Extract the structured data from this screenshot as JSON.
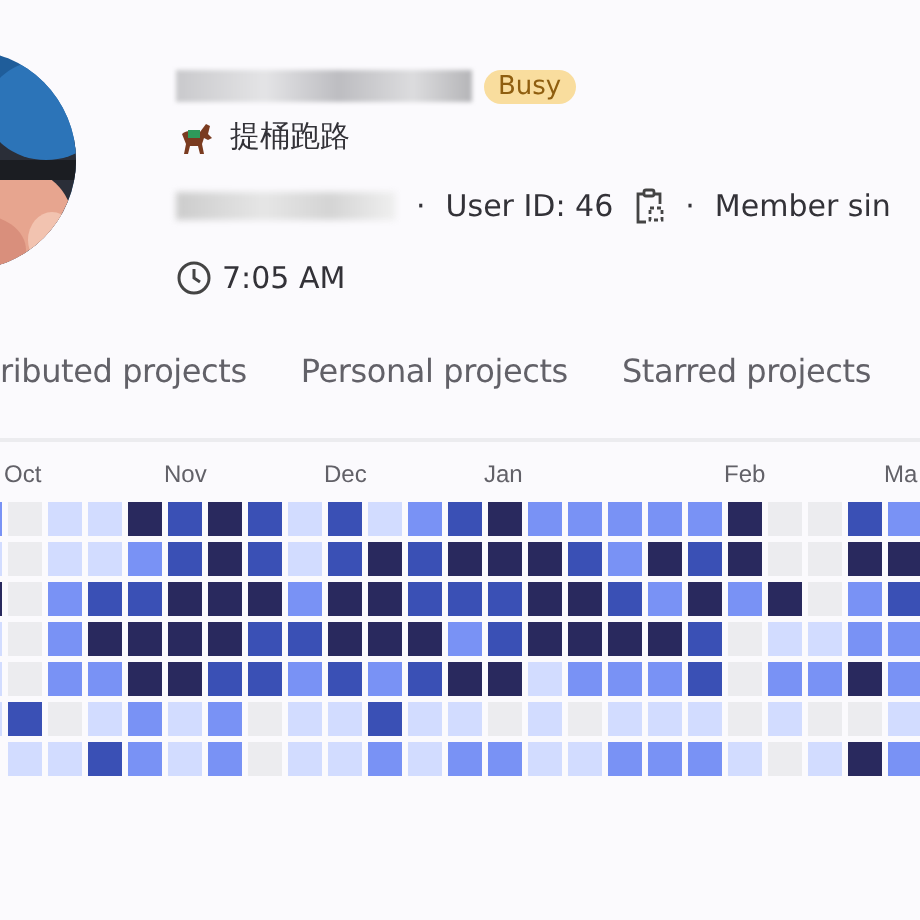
{
  "profile": {
    "badge": "Busy",
    "status": "提桶跑路",
    "separator_1": "·",
    "user_id": "User ID: 46",
    "separator_2": "·",
    "member_since": "Member sin",
    "local_time": "7:05 AM"
  },
  "tabs": [
    {
      "label": "ributed projects"
    },
    {
      "label": "Personal projects"
    },
    {
      "label": "Starred projects"
    }
  ],
  "calendar": {
    "weeks": [
      {
        "days": [
          {
            "color": "#7992f5"
          },
          {
            "color": "#d2dcff"
          },
          {
            "color": "#29295e"
          },
          {
            "color": "#d2dcff"
          },
          {
            "color": "#d2dcff"
          },
          {
            "color": "#d2dcff"
          }
        ]
      },
      {
        "month": "Oct",
        "days": [
          {
            "color": "#ececef"
          },
          {
            "color": "#ececef"
          },
          {
            "color": "#ececef"
          },
          {
            "color": "#ececef"
          },
          {
            "color": "#ececef"
          },
          {
            "color": "#3a50b5"
          },
          {
            "color": "#d2dcff"
          }
        ]
      },
      {
        "days": [
          {
            "color": "#d2dcff"
          },
          {
            "color": "#d2dcff"
          },
          {
            "color": "#7992f5"
          },
          {
            "color": "#7992f5"
          },
          {
            "color": "#7992f5"
          },
          {
            "color": "#ececef"
          },
          {
            "color": "#d2dcff"
          }
        ]
      },
      {
        "days": [
          {
            "color": "#d2dcff"
          },
          {
            "color": "#d2dcff"
          },
          {
            "color": "#3a50b5"
          },
          {
            "color": "#29295e"
          },
          {
            "color": "#7992f5"
          },
          {
            "color": "#d2dcff"
          },
          {
            "color": "#3a50b5"
          }
        ]
      },
      {
        "days": [
          {
            "color": "#29295e"
          },
          {
            "color": "#7992f5"
          },
          {
            "color": "#3a50b5"
          },
          {
            "color": "#29295e"
          },
          {
            "color": "#29295e"
          },
          {
            "color": "#7992f5"
          },
          {
            "color": "#7992f5"
          }
        ]
      },
      {
        "month": "Nov",
        "days": [
          {
            "color": "#3a50b5"
          },
          {
            "color": "#3a50b5"
          },
          {
            "color": "#29295e"
          },
          {
            "color": "#29295e"
          },
          {
            "color": "#29295e"
          },
          {
            "color": "#d2dcff"
          },
          {
            "color": "#d2dcff"
          }
        ]
      },
      {
        "days": [
          {
            "color": "#29295e"
          },
          {
            "color": "#29295e"
          },
          {
            "color": "#29295e"
          },
          {
            "color": "#29295e"
          },
          {
            "color": "#3a50b5"
          },
          {
            "color": "#7992f5"
          },
          {
            "color": "#7992f5"
          }
        ]
      },
      {
        "days": [
          {
            "color": "#3a50b5"
          },
          {
            "color": "#3a50b5"
          },
          {
            "color": "#29295e"
          },
          {
            "color": "#3a50b5"
          },
          {
            "color": "#3a50b5"
          },
          {
            "color": "#ececef"
          },
          {
            "color": "#ececef"
          }
        ]
      },
      {
        "days": [
          {
            "color": "#d2dcff"
          },
          {
            "color": "#d2dcff"
          },
          {
            "color": "#7992f5"
          },
          {
            "color": "#3a50b5"
          },
          {
            "color": "#7992f5"
          },
          {
            "color": "#d2dcff"
          },
          {
            "color": "#d2dcff"
          }
        ]
      },
      {
        "month": "Dec",
        "days": [
          {
            "color": "#3a50b5"
          },
          {
            "color": "#3a50b5"
          },
          {
            "color": "#29295e"
          },
          {
            "color": "#29295e"
          },
          {
            "color": "#3a50b5"
          },
          {
            "color": "#d2dcff"
          },
          {
            "color": "#d2dcff"
          }
        ]
      },
      {
        "days": [
          {
            "color": "#d2dcff"
          },
          {
            "color": "#29295e"
          },
          {
            "color": "#29295e"
          },
          {
            "color": "#29295e"
          },
          {
            "color": "#7992f5"
          },
          {
            "color": "#3a50b5"
          },
          {
            "color": "#7992f5"
          }
        ]
      },
      {
        "days": [
          {
            "color": "#7992f5"
          },
          {
            "color": "#3a50b5"
          },
          {
            "color": "#3a50b5"
          },
          {
            "color": "#29295e"
          },
          {
            "color": "#3a50b5"
          },
          {
            "color": "#d2dcff"
          },
          {
            "color": "#d2dcff"
          }
        ]
      },
      {
        "days": [
          {
            "color": "#3a50b5"
          },
          {
            "color": "#29295e"
          },
          {
            "color": "#3a50b5"
          },
          {
            "color": "#7992f5"
          },
          {
            "color": "#29295e"
          },
          {
            "color": "#d2dcff"
          },
          {
            "color": "#7992f5"
          }
        ]
      },
      {
        "month": "Jan",
        "days": [
          {
            "color": "#29295e"
          },
          {
            "color": "#29295e"
          },
          {
            "color": "#3a50b5"
          },
          {
            "color": "#3a50b5"
          },
          {
            "color": "#29295e"
          },
          {
            "color": "#ececef"
          },
          {
            "color": "#7992f5"
          }
        ]
      },
      {
        "days": [
          {
            "color": "#7992f5"
          },
          {
            "color": "#29295e"
          },
          {
            "color": "#29295e"
          },
          {
            "color": "#29295e"
          },
          {
            "color": "#d2dcff"
          },
          {
            "color": "#d2dcff"
          },
          {
            "color": "#d2dcff"
          }
        ]
      },
      {
        "days": [
          {
            "color": "#7992f5"
          },
          {
            "color": "#3a50b5"
          },
          {
            "color": "#29295e"
          },
          {
            "color": "#29295e"
          },
          {
            "color": "#7992f5"
          },
          {
            "color": "#ececef"
          },
          {
            "color": "#d2dcff"
          }
        ]
      },
      {
        "days": [
          {
            "color": "#7992f5"
          },
          {
            "color": "#7992f5"
          },
          {
            "color": "#3a50b5"
          },
          {
            "color": "#29295e"
          },
          {
            "color": "#7992f5"
          },
          {
            "color": "#d2dcff"
          },
          {
            "color": "#7992f5"
          }
        ]
      },
      {
        "days": [
          {
            "color": "#7992f5"
          },
          {
            "color": "#29295e"
          },
          {
            "color": "#7992f5"
          },
          {
            "color": "#29295e"
          },
          {
            "color": "#7992f5"
          },
          {
            "color": "#d2dcff"
          },
          {
            "color": "#7992f5"
          }
        ]
      },
      {
        "days": [
          {
            "color": "#7992f5"
          },
          {
            "color": "#3a50b5"
          },
          {
            "color": "#29295e"
          },
          {
            "color": "#3a50b5"
          },
          {
            "color": "#3a50b5"
          },
          {
            "color": "#d2dcff"
          },
          {
            "color": "#7992f5"
          }
        ]
      },
      {
        "month": "Feb",
        "days": [
          {
            "color": "#29295e"
          },
          {
            "color": "#29295e"
          },
          {
            "color": "#7992f5"
          },
          {
            "color": "#ececef"
          },
          {
            "color": "#ececef"
          },
          {
            "color": "#ececef"
          },
          {
            "color": "#d2dcff"
          }
        ]
      },
      {
        "days": [
          {
            "color": "#ececef"
          },
          {
            "color": "#ececef"
          },
          {
            "color": "#29295e"
          },
          {
            "color": "#d2dcff"
          },
          {
            "color": "#7992f5"
          },
          {
            "color": "#d2dcff"
          },
          {
            "color": "#ececef"
          }
        ]
      },
      {
        "days": [
          {
            "color": "#ececef"
          },
          {
            "color": "#ececef"
          },
          {
            "color": "#ececef"
          },
          {
            "color": "#d2dcff"
          },
          {
            "color": "#7992f5"
          },
          {
            "color": "#ececef"
          },
          {
            "color": "#d2dcff"
          }
        ]
      },
      {
        "days": [
          {
            "color": "#3a50b5"
          },
          {
            "color": "#29295e"
          },
          {
            "color": "#7992f5"
          },
          {
            "color": "#7992f5"
          },
          {
            "color": "#29295e"
          },
          {
            "color": "#ececef"
          },
          {
            "color": "#29295e"
          }
        ]
      },
      {
        "month": "Ma",
        "days": [
          {
            "color": "#7992f5"
          },
          {
            "color": "#29295e"
          },
          {
            "color": "#3a50b5"
          },
          {
            "color": "#7992f5"
          },
          {
            "color": "#7992f5"
          },
          {
            "color": "#d2dcff"
          },
          {
            "color": "#7992f5"
          }
        ]
      }
    ]
  }
}
